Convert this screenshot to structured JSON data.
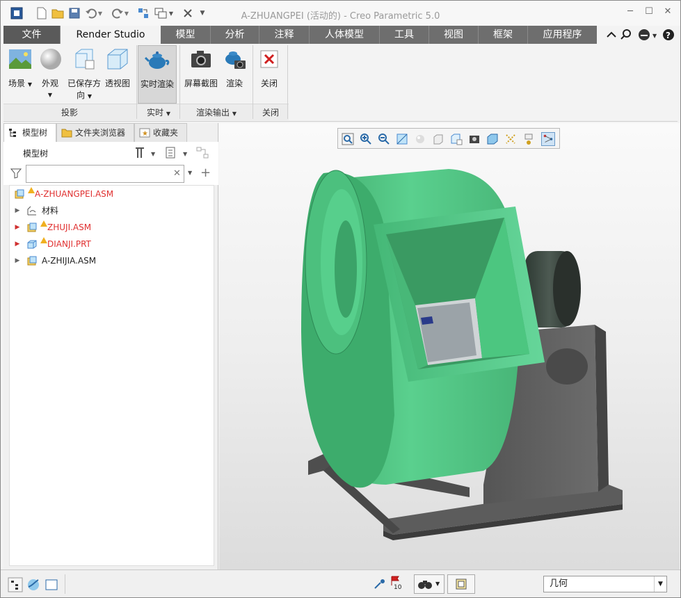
{
  "window": {
    "title": "A-ZHUANGPEI (活动的) - Creo Parametric 5.0",
    "controls": [
      "minimize",
      "maximize",
      "close"
    ]
  },
  "quick_access": [
    "app-icon",
    "new-icon",
    "open-icon",
    "save-icon",
    "undo-icon",
    "redo-icon",
    "regenerate-icon",
    "windows-icon",
    "close-window-icon",
    "customize-icon"
  ],
  "ribbon_tabs": [
    {
      "label": "文件",
      "active": false
    },
    {
      "label": "Render Studio",
      "active": true
    },
    {
      "label": "模型",
      "active": false
    },
    {
      "label": "分析",
      "active": false
    },
    {
      "label": "注释",
      "active": false
    },
    {
      "label": "人体模型",
      "active": false
    },
    {
      "label": "工具",
      "active": false
    },
    {
      "label": "视图",
      "active": false
    },
    {
      "label": "框架",
      "active": false
    },
    {
      "label": "应用程序",
      "active": false
    }
  ],
  "ribbon": {
    "buttons": {
      "scene": "场景",
      "appearance": "外观",
      "saved_orient_1": "已保存方",
      "saved_orient_2": "向",
      "perspective": "透视图",
      "realtime_render": "实时渲染",
      "screenshot": "屏幕截图",
      "render": "渲染",
      "close": "关闭"
    },
    "groups": {
      "projection": "投影",
      "realtime": "实时",
      "render_output": "渲染输出",
      "close": "关闭"
    }
  },
  "left_panel": {
    "tabs": [
      "模型树",
      "文件夹浏览器",
      "收藏夹"
    ],
    "header": "模型树",
    "search": {
      "value": "",
      "placeholder": ""
    },
    "tree": [
      {
        "label": "A-ZHUANGPEI.ASM",
        "level": 0,
        "warning": true,
        "error": true,
        "expander": "none",
        "icon": "assembly-icon"
      },
      {
        "label": "材料",
        "level": 1,
        "warning": false,
        "error": false,
        "expander": "collapsed",
        "icon": "material-icon"
      },
      {
        "label": "ZHUJI.ASM",
        "level": 1,
        "warning": true,
        "error": true,
        "expander": "collapsed-red",
        "icon": "assembly-icon"
      },
      {
        "label": "DIANJI.PRT",
        "level": 1,
        "warning": true,
        "error": true,
        "expander": "collapsed-red",
        "icon": "part-icon"
      },
      {
        "label": "A-ZHIJIA.ASM",
        "level": 1,
        "warning": false,
        "error": false,
        "expander": "collapsed",
        "icon": "assembly-icon"
      }
    ]
  },
  "status_bar": {
    "selection_filter": "几何",
    "message_count": "10"
  },
  "colors": {
    "fan_green": "#4fc984",
    "frame_gray": "#5a5a5a",
    "tab_bar": "#6e6e6e",
    "error_red": "#e03030"
  }
}
